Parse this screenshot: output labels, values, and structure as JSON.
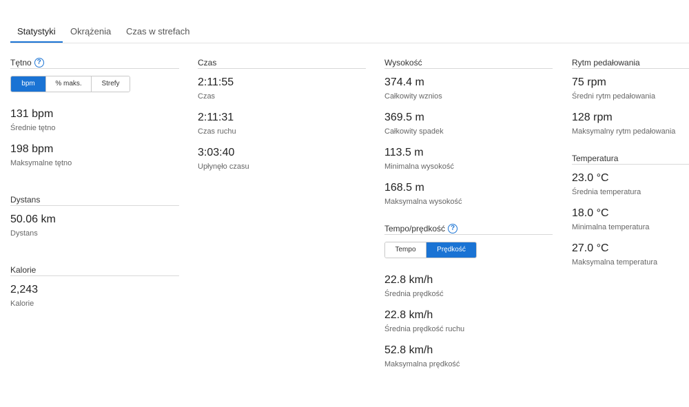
{
  "tabs": [
    {
      "label": "Statystyki",
      "active": true
    },
    {
      "label": "Okrążenia",
      "active": false
    },
    {
      "label": "Czas w strefach",
      "active": false
    }
  ],
  "heart": {
    "title": "Tętno",
    "toggle": [
      "bpm",
      "% maks.",
      "Strefy"
    ],
    "selected": "bpm",
    "stats": [
      {
        "value": "131 bpm",
        "label": "Średnie tętno"
      },
      {
        "value": "198 bpm",
        "label": "Maksymalne tętno"
      }
    ]
  },
  "distance": {
    "title": "Dystans",
    "stats": [
      {
        "value": "50.06 km",
        "label": "Dystans"
      }
    ]
  },
  "calories": {
    "title": "Kalorie",
    "stats": [
      {
        "value": "2,243",
        "label": "Kalorie"
      }
    ]
  },
  "time": {
    "title": "Czas",
    "stats": [
      {
        "value": "2:11:55",
        "label": "Czas"
      },
      {
        "value": "2:11:31",
        "label": "Czas ruchu"
      },
      {
        "value": "3:03:40",
        "label": "Upłynęło czasu"
      }
    ]
  },
  "elevation": {
    "title": "Wysokość",
    "stats": [
      {
        "value": "374.4 m",
        "label": "Całkowity wznios"
      },
      {
        "value": "369.5 m",
        "label": "Całkowity spadek"
      },
      {
        "value": "113.5 m",
        "label": "Minimalna wysokość"
      },
      {
        "value": "168.5 m",
        "label": "Maksymalna wysokość"
      }
    ]
  },
  "speed": {
    "title": "Tempo/prędkość",
    "toggle": [
      "Tempo",
      "Prędkość"
    ],
    "selected": "Prędkość",
    "stats": [
      {
        "value": "22.8 km/h",
        "label": "Średnia prędkość"
      },
      {
        "value": "22.8 km/h",
        "label": "Średnia prędkość ruchu"
      },
      {
        "value": "52.8 km/h",
        "label": "Maksymalna prędkość"
      }
    ]
  },
  "cadence": {
    "title": "Rytm pedałowania",
    "stats": [
      {
        "value": "75 rpm",
        "label": "Średni rytm pedałowania"
      },
      {
        "value": "128 rpm",
        "label": "Maksymalny rytm pedałowania"
      }
    ]
  },
  "temperature": {
    "title": "Temperatura",
    "stats": [
      {
        "value": "23.0 °C",
        "label": "Średnia temperatura"
      },
      {
        "value": "18.0 °C",
        "label": "Minimalna temperatura"
      },
      {
        "value": "27.0 °C",
        "label": "Maksymalna temperatura"
      }
    ]
  },
  "help_glyph": "?",
  "colors": {
    "accent": "#1a73d4"
  }
}
